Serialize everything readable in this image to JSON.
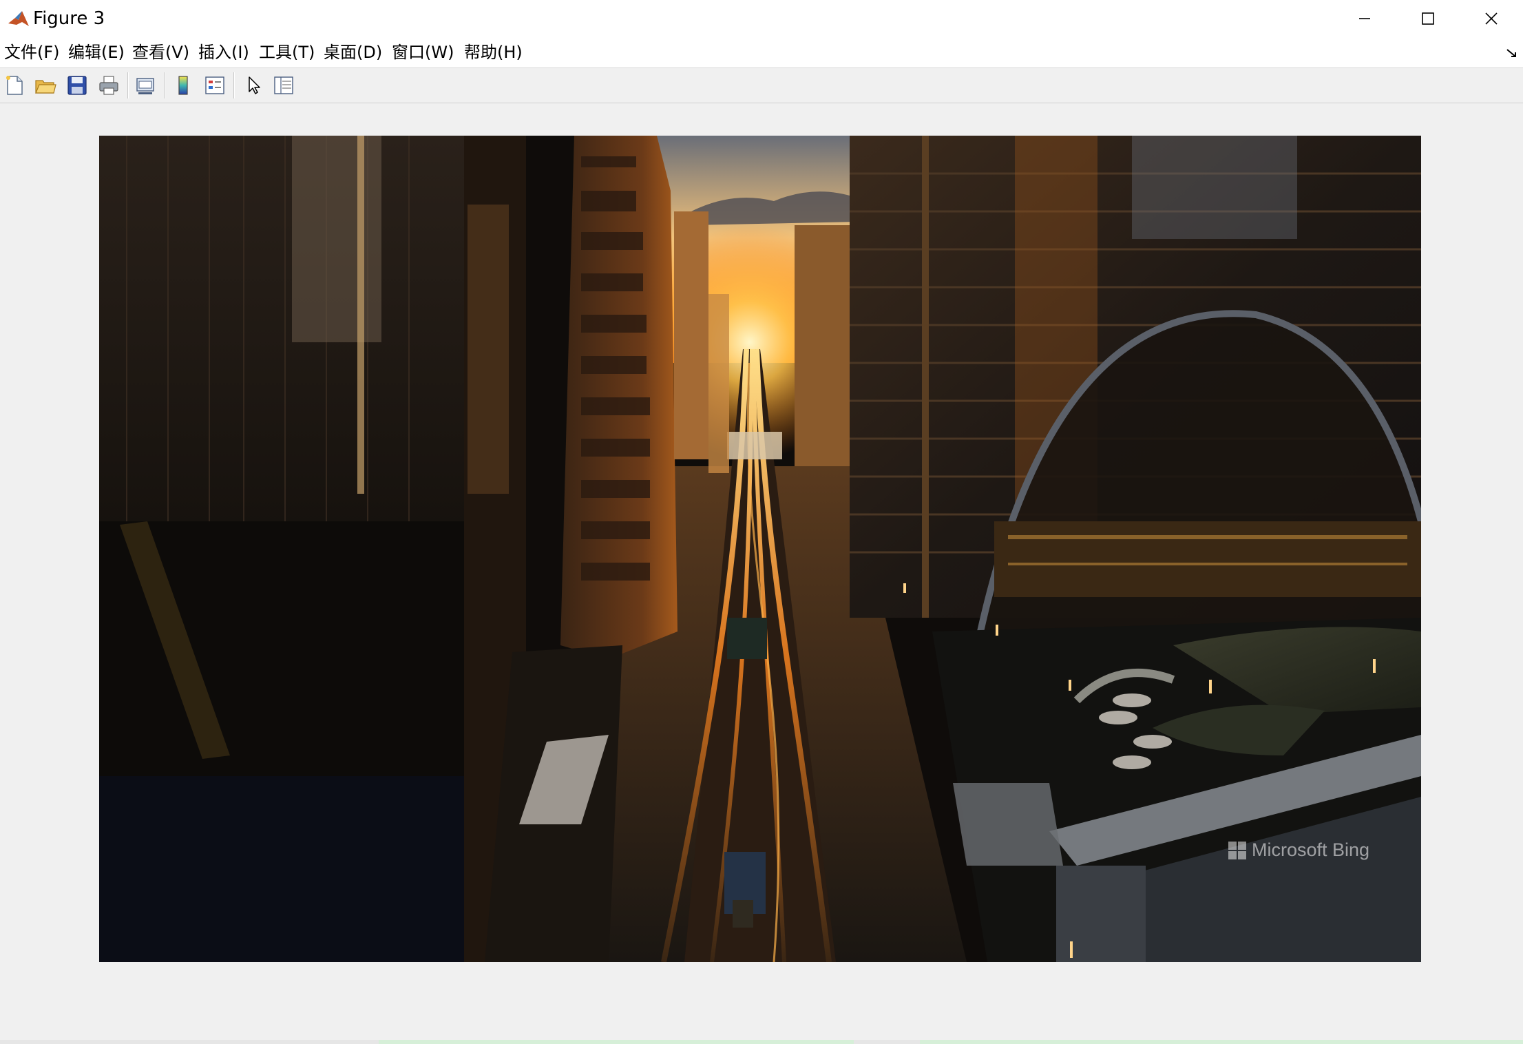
{
  "window": {
    "title": "Figure 3",
    "controls": {
      "minimize": "—",
      "maximize": "☐",
      "close": "✕"
    }
  },
  "menu": {
    "items": [
      {
        "label": "文件(F)"
      },
      {
        "label": "编辑(E)"
      },
      {
        "label": "查看(V)"
      },
      {
        "label": "插入(I)"
      },
      {
        "label": "工具(T)"
      },
      {
        "label": "桌面(D)"
      },
      {
        "label": "窗口(W)"
      },
      {
        "label": "帮助(H)"
      }
    ]
  },
  "toolbar": {
    "buttons": [
      {
        "icon": "new-figure-icon"
      },
      {
        "icon": "open-file-icon"
      },
      {
        "icon": "save-icon"
      },
      {
        "icon": "print-icon"
      },
      {
        "icon": "link-plot-icon"
      },
      {
        "icon": "colorbar-icon"
      },
      {
        "icon": "legend-icon"
      },
      {
        "icon": "edit-plot-arrow-icon"
      },
      {
        "icon": "property-inspector-icon"
      }
    ]
  },
  "figure": {
    "image_description": "Aerial photo of elevated railway tracks between skyscrapers at sunset",
    "watermark": "Microsoft Bing"
  },
  "colors": {
    "background": "#f0f0f0",
    "titlebar": "#ffffff",
    "sunset": "#f7a53a"
  }
}
